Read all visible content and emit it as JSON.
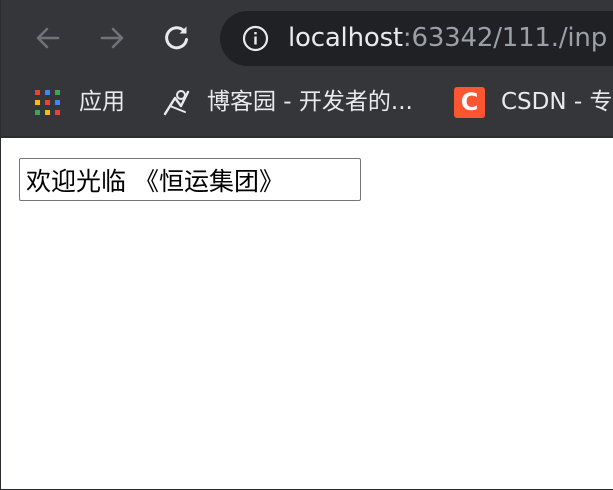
{
  "browser": {
    "url_host": "localhost",
    "url_rest": ":63342/111./inp",
    "icons": {
      "back": "arrow-left-icon",
      "forward": "arrow-right-icon",
      "reload": "reload-icon",
      "site_info": "info-circle-icon"
    }
  },
  "bookmarks": {
    "items": [
      {
        "label": "应用",
        "icon": "apps-grid-icon"
      },
      {
        "label": "博客园 - 开发者的...",
        "icon": "cnblogs-icon"
      },
      {
        "label": "CSDN - 专",
        "icon": "csdn-icon",
        "icon_letter": "C"
      }
    ]
  },
  "page": {
    "text_input": {
      "value": "欢迎光临 《恒运集团》"
    }
  },
  "colors": {
    "toolbar_bg": "#35363a",
    "omnibox_bg": "#202124",
    "url_host": "#e8eaed",
    "url_rest": "#9aa0a6",
    "csdn_brand": "#fc5531"
  }
}
